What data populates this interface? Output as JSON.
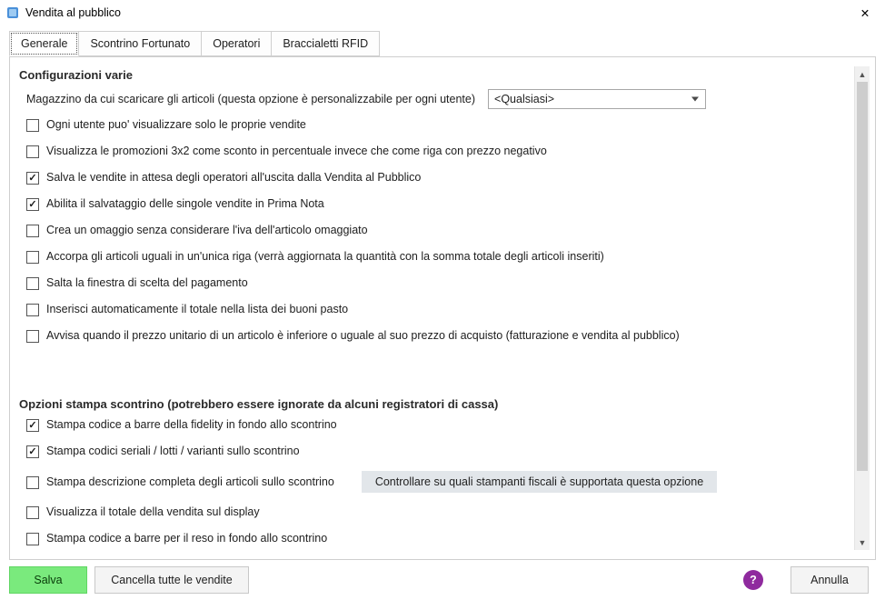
{
  "window": {
    "title": "Vendita al pubblico",
    "close_symbol": "✕"
  },
  "tabs": {
    "generale": "Generale",
    "scontrino": "Scontrino Fortunato",
    "operatori": "Operatori",
    "braccialetti": "Braccialetti RFID"
  },
  "group1": {
    "title": "Configurazioni varie",
    "magazzino_label": "Magazzino da cui scaricare gli articoli (questa opzione è personalizzabile per ogni utente)",
    "magazzino_select": "<Qualsiasi>",
    "chk_ogni_utente": "Ogni utente puo' visualizzare solo le proprie vendite",
    "chk_visualizza_promo": "Visualizza le promozioni 3x2 come sconto in percentuale invece che come riga con prezzo negativo",
    "chk_salva_vendite": "Salva le vendite in attesa degli operatori all'uscita dalla Vendita al Pubblico",
    "chk_abilita_prima_nota": "Abilita il salvataggio delle singole vendite in Prima Nota",
    "chk_crea_omaggio": "Crea un omaggio senza considerare l'iva dell'articolo omaggiato",
    "chk_accorpa": "Accorpa gli articoli uguali in un'unica riga (verrà aggiornata la quantità con la somma totale degli articoli inseriti)",
    "chk_salta_finestra": "Salta la finestra di scelta del pagamento",
    "chk_inserisci_auto": "Inserisci automaticamente il totale nella lista dei buoni pasto",
    "chk_avvisa": "Avvisa quando il prezzo unitario di un articolo è inferiore o uguale al suo prezzo di acquisto (fatturazione e vendita al pubblico)"
  },
  "group2": {
    "title": "Opzioni stampa scontrino (potrebbero essere ignorate da alcuni registratori di cassa)",
    "chk_stampa_barre_fidelity": "Stampa codice a barre della fidelity in fondo allo scontrino",
    "chk_stampa_seriali": "Stampa codici seriali / lotti / varianti sullo scontrino",
    "chk_stampa_descr": "Stampa descrizione completa degli articoli sullo scontrino",
    "hint_controllare": "Controllare su quali stampanti fiscali è supportata questa opzione",
    "chk_visualizza_totale": "Visualizza il totale della vendita sul display",
    "chk_stampa_barre_reso": "Stampa codice a barre per il reso in fondo allo scontrino"
  },
  "bottom": {
    "salva": "Salva",
    "cancella": "Cancella tutte le vendite",
    "annulla": "Annulla",
    "help_glyph": "?"
  }
}
